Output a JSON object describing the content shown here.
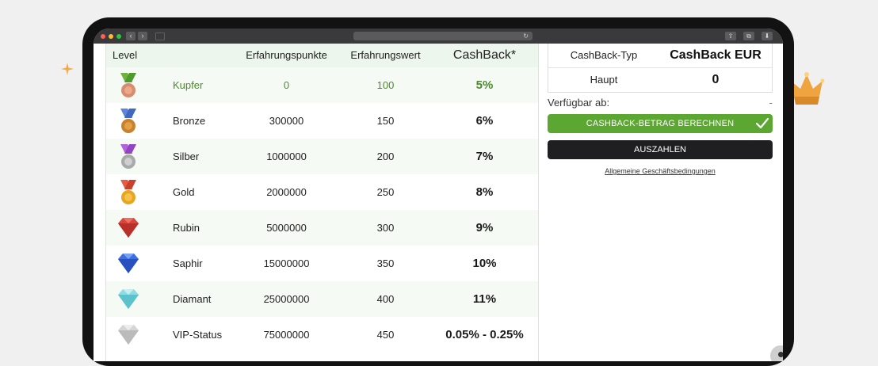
{
  "browser": {
    "back": "‹",
    "forward": "›",
    "reload": "↻",
    "share": "⇧",
    "tabs": "⧉",
    "downloads": "⬇"
  },
  "table": {
    "headers": {
      "level": "Level",
      "experience_points": "Erfahrungspunkte",
      "experience_value": "Erfahrungswert",
      "cashback": "CashBack*"
    },
    "rows": [
      {
        "name": "Kupfer",
        "points": "0",
        "value": "100",
        "cashback": "5%",
        "icon": "copper-medal-icon",
        "current": true
      },
      {
        "name": "Bronze",
        "points": "300000",
        "value": "150",
        "cashback": "6%",
        "icon": "bronze-medal-icon"
      },
      {
        "name": "Silber",
        "points": "1000000",
        "value": "200",
        "cashback": "7%",
        "icon": "silver-medal-icon"
      },
      {
        "name": "Gold",
        "points": "2000000",
        "value": "250",
        "cashback": "8%",
        "icon": "gold-medal-icon"
      },
      {
        "name": "Rubin",
        "points": "5000000",
        "value": "300",
        "cashback": "9%",
        "icon": "ruby-gem-icon"
      },
      {
        "name": "Saphir",
        "points": "15000000",
        "value": "350",
        "cashback": "10%",
        "icon": "sapphire-gem-icon"
      },
      {
        "name": "Diamant",
        "points": "25000000",
        "value": "400",
        "cashback": "11%",
        "icon": "diamond-gem-icon"
      },
      {
        "name": "VIP-Status",
        "points": "75000000",
        "value": "450",
        "cashback": "0.05% - 0.25%",
        "icon": "vip-gem-icon"
      }
    ]
  },
  "panel": {
    "type_label": "CashBack-Typ",
    "type_value": "CashBack EUR",
    "main_label": "Haupt",
    "main_value": "0",
    "available_label": "Verfügbar ab:",
    "available_value": "-",
    "calculate_button": "CASHBACK-BETRAG BERECHNEN",
    "payout_button": "AUSZAHLEN",
    "terms_link": "Allgemeine Geschäftsbedingungen"
  },
  "colors": {
    "accent_green": "#5ca632",
    "current_level_text": "#4d8a2c",
    "header_bg": "#edf6ec",
    "dark_button": "#1f1f21"
  }
}
